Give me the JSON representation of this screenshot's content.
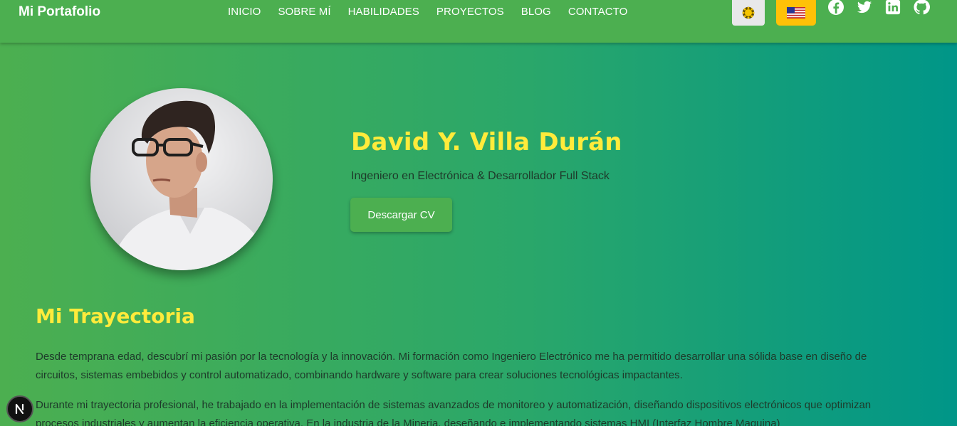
{
  "header": {
    "brand": "Mi Portafolio",
    "nav": [
      "INICIO",
      "SOBRE MÍ",
      "HABILIDADES",
      "PROYECTOS",
      "BLOG",
      "CONTACTO"
    ],
    "theme_icon": "sun-icon",
    "language_icon": "us-flag-icon",
    "socials": [
      "facebook-icon",
      "twitter-icon",
      "linkedin-icon",
      "github-icon"
    ]
  },
  "hero": {
    "name": "David Y. Villa Durán",
    "role": "Ingeniero en Electrónica & Desarrollador Full Stack",
    "cv_button": "Descargar CV"
  },
  "trajectory": {
    "title": "Mi Trayectoria",
    "paragraphs": [
      "Desde temprana edad, descubrí mi pasión por la tecnología y la innovación. Mi formación como Ingeniero Electrónico me ha permitido desarrollar una sólida base en diseño de circuitos, sistemas embebidos y control automatizado, combinando hardware y software para crear soluciones tecnológicas impactantes.",
      "Durante mi trayectoria profesional, he trabajado en la implementación de sistemas avanzados de monitoreo y automatización, diseñando dispositivos electrónicos que optimizan procesos industriales y aumentan la eficiencia operativa. En la industria de la Mineria, deseñando e implementando sistemas HMI (Interfaz Hombre Maquina)"
    ]
  },
  "next_badge": "N",
  "colors": {
    "primary": "#4caf50",
    "accent": "#ffeb3b",
    "gradient_end": "#009688",
    "language_button": "#ffc107"
  }
}
